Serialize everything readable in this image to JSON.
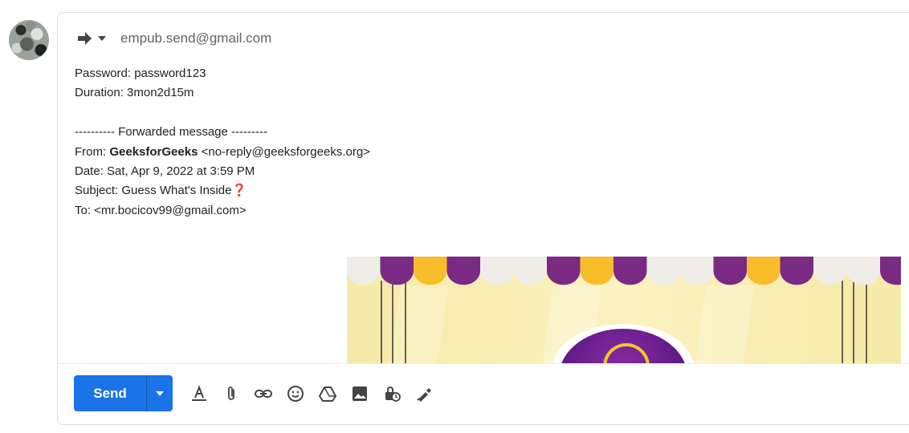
{
  "header": {
    "reply_icon": "forward-arrow-icon",
    "caret_icon": "chevron-down-icon",
    "to_address": "empub.send@gmail.com"
  },
  "body": {
    "password_line": "Password: password123",
    "duration_line": "Duration: 3mon2d15m",
    "forward_header": "---------- Forwarded message ---------",
    "from_label": "From: ",
    "from_name": "GeeksforGeeks",
    "from_email": " <no-reply@geeksforgeeks.org>",
    "date_line": "Date: Sat, Apr 9, 2022 at 3:59 PM",
    "subject_line": "Subject: Guess What's Inside",
    "subject_emoji": "❓",
    "to_line": "To: <mr.bocicov99@gmail.com>"
  },
  "toolbar": {
    "send_label": "Send",
    "icons": [
      "formatting-icon",
      "attach-icon",
      "link-icon",
      "emoji-icon",
      "drive-icon",
      "photo-icon",
      "confidential-icon",
      "signature-icon"
    ]
  },
  "colors": {
    "send_blue": "#1a73e8",
    "awning_purple": "#7b2a83",
    "awning_yellow": "#f8bd2a",
    "awning_white": "#efede8",
    "banner_bg": "#f7eeb0"
  }
}
